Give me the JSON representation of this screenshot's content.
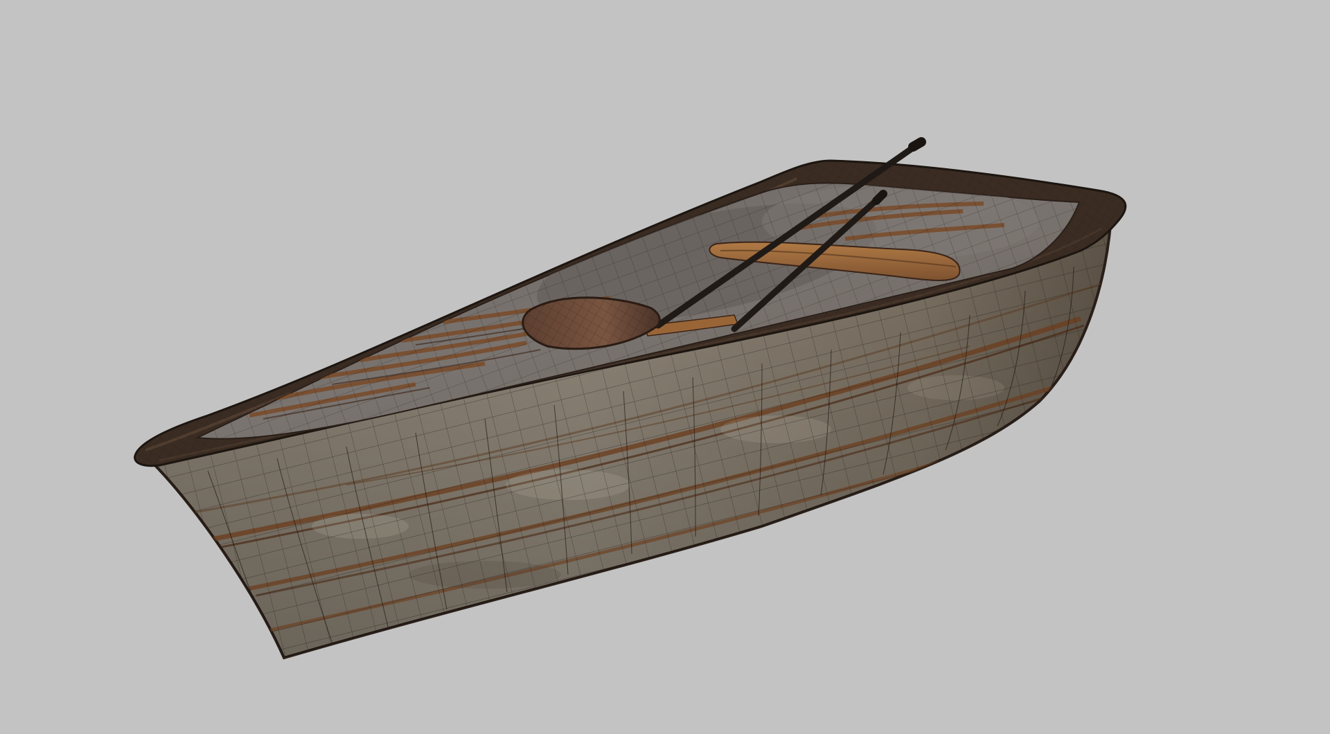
{
  "viewport": {
    "background_color": "#c3c3c3",
    "render_mode": "textured-wireframe"
  },
  "model": {
    "subject": "wooden rowboat",
    "parts": [
      "hull",
      "gunwale-rim",
      "interior",
      "floor-planks",
      "seat",
      "oar-1",
      "oar-2"
    ],
    "colors": {
      "rim": "#2a1f19",
      "hull_face": "#8e8577",
      "hull_shadow": "#5d5246",
      "interior": "#716a66",
      "interior_deep": "#5e5753",
      "plank_streak": "#6b3f1f",
      "seat": "#9a6536",
      "oar_blade": "#6d4c3a",
      "oar_shaft": "#201a17",
      "wire": "#1a1410"
    }
  }
}
